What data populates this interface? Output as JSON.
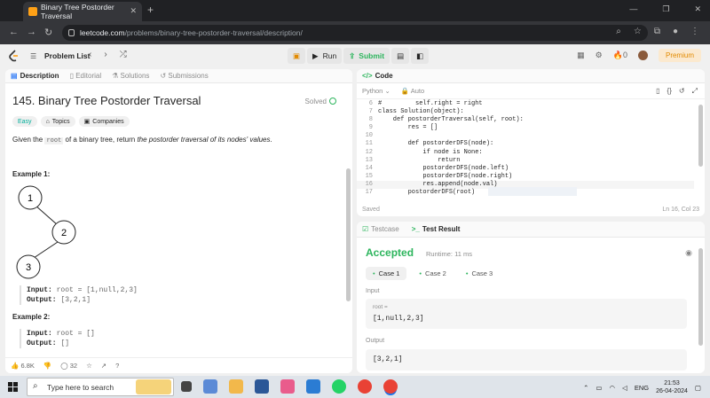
{
  "browser": {
    "tab_title": "Binary Tree Postorder Traversal",
    "url_host": "leetcode.com",
    "url_path": "/problems/binary-tree-postorder-traversal/description/"
  },
  "topbar": {
    "problem_list": "Problem List",
    "run": "Run",
    "submit": "Submit",
    "streak": "0",
    "premium": "Premium"
  },
  "left": {
    "tabs": [
      "Description",
      "Editorial",
      "Solutions",
      "Submissions"
    ],
    "title": "145. Binary Tree Postorder Traversal",
    "solved": "Solved",
    "badges": [
      "Easy",
      "Topics",
      "Companies"
    ],
    "desc_pre": "Given the ",
    "desc_code": "root",
    "desc_mid": " of a binary tree, return ",
    "desc_italic": "the postorder traversal of its nodes' values",
    "desc_post": ".",
    "example1": "Example 1:",
    "example2": "Example 2:",
    "tree_nodes": [
      "1",
      "2",
      "3"
    ],
    "ex1_input_label": "Input:",
    "ex1_input": "root = [1,null,2,3]",
    "ex1_output_label": "Output:",
    "ex1_output": "[3,2,1]",
    "ex2_input_label": "Input:",
    "ex2_input": "root = []",
    "ex2_output_label": "Output:",
    "ex2_output": "[]",
    "likes": "6.8K",
    "comments": "32"
  },
  "code": {
    "header": "Code",
    "language": "Python",
    "autosave": "Auto",
    "lines": [
      {
        "n": "6",
        "t": "#         self.right = right"
      },
      {
        "n": "7",
        "t": "class Solution(object):"
      },
      {
        "n": "8",
        "t": "    def postorderTraversal(self, root):"
      },
      {
        "n": "9",
        "t": "        res = []"
      },
      {
        "n": "10",
        "t": ""
      },
      {
        "n": "11",
        "t": "        def postorderDFS(node):"
      },
      {
        "n": "12",
        "t": "            if node is None:"
      },
      {
        "n": "13",
        "t": "                return"
      },
      {
        "n": "14",
        "t": "            postorderDFS(node.left)"
      },
      {
        "n": "15",
        "t": "            postorderDFS(node.right)"
      },
      {
        "n": "16",
        "t": "            res.append(node.val)"
      },
      {
        "n": "17",
        "t": "        postorderDFS(root)"
      }
    ],
    "saved": "Saved",
    "position": "Ln 16, Col 23"
  },
  "test": {
    "tabs": [
      "Testcase",
      "Test Result"
    ],
    "status": "Accepted",
    "runtime": "Runtime: 11 ms",
    "cases": [
      "Case 1",
      "Case 2",
      "Case 3"
    ],
    "input_label": "Input",
    "var_name": "root =",
    "var_value": "[1,null,2,3]",
    "output_label": "Output",
    "output_value": "[3,2,1]"
  },
  "taskbar": {
    "search_placeholder": "Type here to search",
    "lang": "ENG",
    "time": "21:53",
    "date": "26-04-2024"
  },
  "colors": {
    "accent_green": "#2db55d",
    "easy": "#00af9b",
    "brand": "#ffa116"
  }
}
